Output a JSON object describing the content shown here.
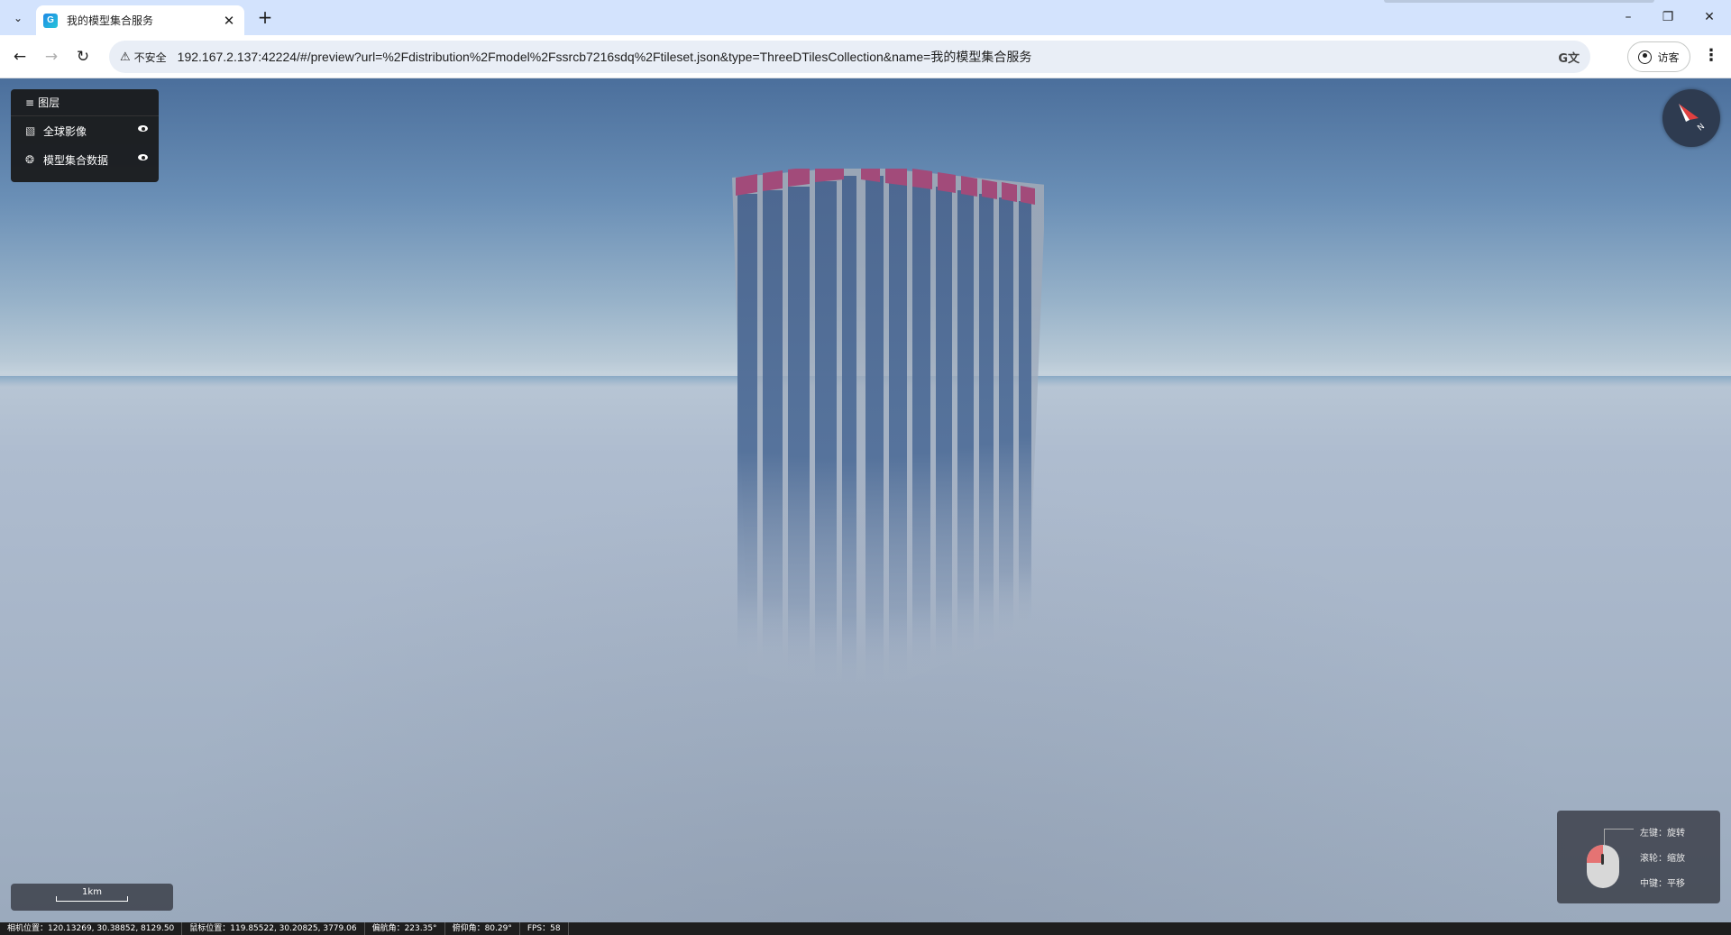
{
  "browser": {
    "tab": {
      "title": "我的模型集合服务",
      "favicon_letter": "G"
    },
    "address": {
      "security_label": "不安全",
      "url": "192.167.2.137:42224/#/preview?url=%2Fdistribution%2Fmodel%2Fssrcb7216sdq%2Ftileset.json&type=ThreeDTilesCollection&name=我的模型集合服务"
    },
    "profile_label": "访客"
  },
  "layers": {
    "header": "图层",
    "items": [
      {
        "label": "全球影像",
        "icon": "image-layer-icon",
        "visible": true
      },
      {
        "label": "模型集合数据",
        "icon": "model-layer-icon",
        "visible": true
      }
    ]
  },
  "scale": {
    "label": "1km"
  },
  "mouse_hints": [
    {
      "text": "左键：旋转"
    },
    {
      "text": "滚轮：缩放"
    },
    {
      "text": "中键：平移"
    }
  ],
  "status": {
    "camera": "相机位置：120.13269, 30.38852, 8129.50",
    "mouse": "鼠标位置：119.85522, 30.20825, 3779.06",
    "heading": "偏航角：223.35°",
    "pitch": "俯仰角：80.29°",
    "fps": "FPS：58"
  },
  "colors": {
    "tabbar": "#d3e3fd",
    "sky_top": "#4b6f9c",
    "building": "#4d6891",
    "roof_accent": "#a24b7a",
    "compass_needle": "#e04040"
  }
}
